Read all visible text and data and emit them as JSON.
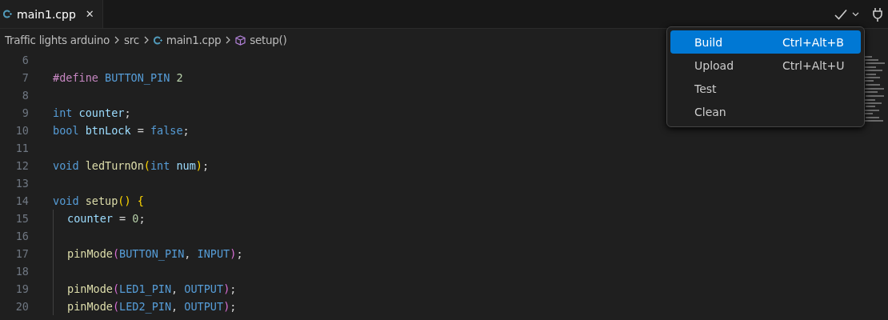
{
  "tab": {
    "label": "main1.cpp",
    "selected": true,
    "close": "✕"
  },
  "breadcrumb": [
    {
      "kind": "folder",
      "label": "Traffic lights arduino"
    },
    {
      "kind": "folder",
      "label": "src"
    },
    {
      "kind": "file",
      "label": "main1.cpp"
    },
    {
      "kind": "symbol",
      "label": "setup()"
    }
  ],
  "code": [
    {
      "number": "6",
      "guide": false
    },
    {
      "number": "7",
      "guide": false,
      "tokens": [
        {
          "kind": "directive",
          "text": "#define "
        },
        {
          "kind": "macro",
          "text": "BUTTON_PIN "
        },
        {
          "kind": "number",
          "text": "2"
        }
      ]
    },
    {
      "number": "8",
      "guide": false
    },
    {
      "number": "9",
      "guide": false,
      "tokens": [
        {
          "kind": "keyword",
          "text": "int "
        },
        {
          "kind": "variable",
          "text": "counter"
        },
        {
          "kind": "plain",
          "text": ";"
        }
      ]
    },
    {
      "number": "10",
      "guide": false,
      "tokens": [
        {
          "kind": "keyword",
          "text": "bool "
        },
        {
          "kind": "variable",
          "text": "btnLock"
        },
        {
          "kind": "plain",
          "text": " = "
        },
        {
          "kind": "keyword",
          "text": "false"
        },
        {
          "kind": "plain",
          "text": ";"
        }
      ]
    },
    {
      "number": "11",
      "guide": false
    },
    {
      "number": "12",
      "guide": false,
      "tokens": [
        {
          "kind": "keyword",
          "text": "void "
        },
        {
          "kind": "function",
          "text": "ledTurnOn"
        },
        {
          "kind": "paren",
          "text": "("
        },
        {
          "kind": "keyword",
          "text": "int "
        },
        {
          "kind": "variable",
          "text": "num"
        },
        {
          "kind": "paren",
          "text": ")"
        },
        {
          "kind": "plain",
          "text": ";"
        }
      ]
    },
    {
      "number": "13",
      "guide": false
    },
    {
      "number": "14",
      "guide": false,
      "tokens": [
        {
          "kind": "keyword",
          "text": "void "
        },
        {
          "kind": "function",
          "text": "setup"
        },
        {
          "kind": "paren",
          "text": "() {"
        }
      ]
    },
    {
      "number": "15",
      "guide": true,
      "tokens": [
        {
          "kind": "variable",
          "text": "counter"
        },
        {
          "kind": "plain",
          "text": " = "
        },
        {
          "kind": "number",
          "text": "0"
        },
        {
          "kind": "plain",
          "text": ";"
        }
      ]
    },
    {
      "number": "16",
      "guide": true
    },
    {
      "number": "17",
      "guide": true,
      "tokens": [
        {
          "kind": "function",
          "text": "pinMode"
        },
        {
          "kind": "paren2",
          "text": "("
        },
        {
          "kind": "macro",
          "text": "BUTTON_PIN"
        },
        {
          "kind": "plain",
          "text": ", "
        },
        {
          "kind": "macro",
          "text": "INPUT"
        },
        {
          "kind": "paren2",
          "text": ")"
        },
        {
          "kind": "plain",
          "text": ";"
        }
      ]
    },
    {
      "number": "18",
      "guide": true
    },
    {
      "number": "19",
      "guide": true,
      "tokens": [
        {
          "kind": "function",
          "text": "pinMode"
        },
        {
          "kind": "paren2",
          "text": "("
        },
        {
          "kind": "macro",
          "text": "LED1_PIN"
        },
        {
          "kind": "plain",
          "text": ", "
        },
        {
          "kind": "macro",
          "text": "OUTPUT"
        },
        {
          "kind": "paren2",
          "text": ")"
        },
        {
          "kind": "plain",
          "text": ";"
        }
      ]
    },
    {
      "number": "20",
      "guide": true,
      "tokens": [
        {
          "kind": "function",
          "text": "pinMode"
        },
        {
          "kind": "paren2",
          "text": "("
        },
        {
          "kind": "macro",
          "text": "LED2_PIN"
        },
        {
          "kind": "plain",
          "text": ", "
        },
        {
          "kind": "macro",
          "text": "OUTPUT"
        },
        {
          "kind": "paren2",
          "text": ")"
        },
        {
          "kind": "plain",
          "text": ";"
        }
      ]
    }
  ],
  "menu": [
    {
      "label": "Build",
      "shortcut": "Ctrl+Alt+B",
      "selected": true
    },
    {
      "label": "Upload",
      "shortcut": "Ctrl+Alt+U",
      "selected": false
    },
    {
      "label": "Test",
      "selected": false
    },
    {
      "label": "Clean",
      "selected": false
    }
  ]
}
